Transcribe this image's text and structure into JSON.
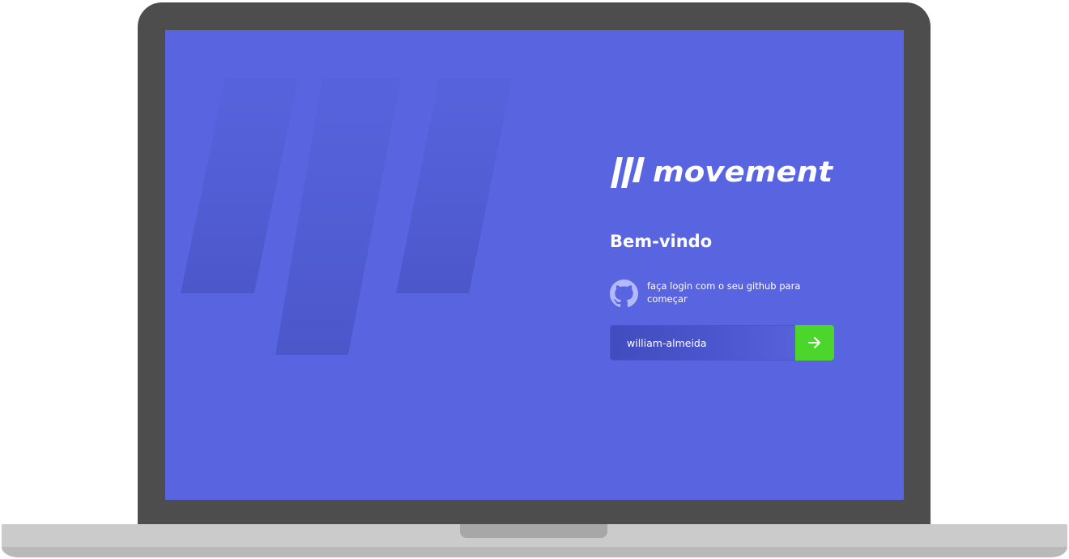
{
  "login": {
    "logo_text": "movement",
    "welcome_title": "Bem-vindo",
    "github_prompt": "faça login com o seu github para começar",
    "username_value": "william-almeida",
    "submit_icon": "arrow-right-icon"
  },
  "colors": {
    "screen_background": "#5965e0",
    "submit_button": "#4cd62b",
    "laptop_frame": "#4d4d4d",
    "laptop_base": "#cbcbcb"
  }
}
